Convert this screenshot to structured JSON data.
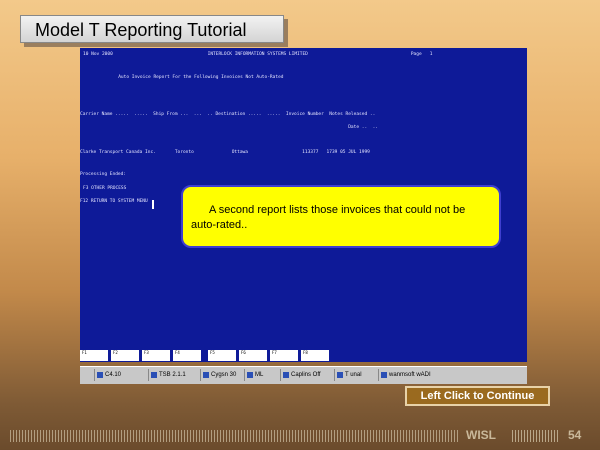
{
  "slide": {
    "title": "Model T Reporting Tutorial",
    "page_number": "54",
    "footer_brand": "WISL"
  },
  "terminal": {
    "lines": [
      "10 Nov 2000                                   INTERLOCK INFORMATION SYSTEMS LIMITED                                      Page   1",
      "             Auto Invoice Report For the Following Invoices Not Auto-Rated",
      "Carrier Name .....  .....  Ship From ...  ...  .. Destination .....  .....  Invoice Number  Notes Released ..",
      "                                                                                                   Date ..  ..",
      "Clarke Transport Canada Inc.       Toronto              Ottawa                    113377   1739 05 JUL 1999",
      "Processing Ended:",
      "F3 OTHER PROCESS",
      "F12 RETURN TO SYSTEM MENU"
    ],
    "fkeys": [
      "F1",
      "F2",
      "F3",
      "F4",
      "F5",
      "F6",
      "F7",
      "F8"
    ]
  },
  "taskbar": {
    "items": [
      "C4.10",
      "TSB 2.1.1",
      "Cygsn 30",
      "ML",
      "Caplins Off",
      "T unal",
      "wanmsoft wADI"
    ]
  },
  "callout": {
    "text": "A second report lists those invoices that could not be auto-rated.."
  },
  "continue_button": {
    "label": "Left Click to Continue"
  },
  "colors": {
    "terminal_bg": "#0e1a98",
    "callout_bg": "#ffff00",
    "callout_border": "#3f3fd0",
    "button_bg": "#9a6a1f"
  }
}
